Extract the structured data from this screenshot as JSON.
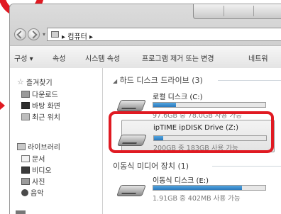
{
  "breadcrumb": {
    "sep": "▸",
    "item": "컴퓨터",
    "trail_sep": "▸"
  },
  "toolbar": {
    "items": [
      "구성 ▾",
      "속성",
      "시스템 속성",
      "프로그램 제거 또는 변경",
      "네트워"
    ]
  },
  "nav": {
    "favorites": {
      "label": "즐겨찾기",
      "items": [
        "다운로드",
        "바탕 화면",
        "최근 위치"
      ]
    },
    "libraries": {
      "label": "라이브러리",
      "items": [
        "문서",
        "비디오",
        "사진",
        "음악"
      ]
    }
  },
  "content": {
    "hdd_group": {
      "arrow": "◢",
      "label": "하드 디스크 드라이브 (3)"
    },
    "removable_group": {
      "label": "이동식 미디어 장치 (1)"
    },
    "drives": [
      {
        "name": "로컬 디스크 (C:)",
        "size": "97.6GB 중 78.0GB 사용 가능",
        "usage": 0.2
      },
      {
        "name": "ipTIME ipDISK Drive (Z:)",
        "size": "200GB 중 183GB 사용 가능",
        "usage": 0.085
      },
      {
        "name": "이동식 디스크 (E:)",
        "size": "1.91GB 중 402MB 사용 가능",
        "usage": 0.79
      }
    ]
  },
  "colors": {
    "accent_red": "#e01a22",
    "usage_bar": "#2b78bc"
  }
}
